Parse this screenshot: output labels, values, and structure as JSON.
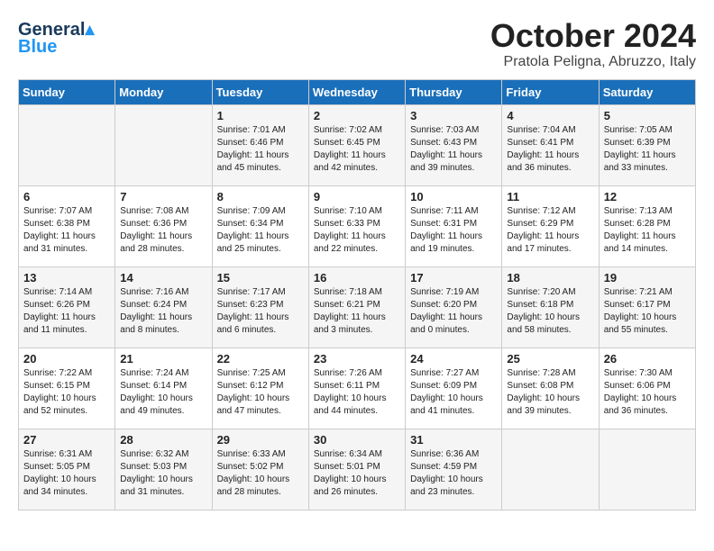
{
  "header": {
    "logo_general": "General",
    "logo_blue": "Blue",
    "month_title": "October 2024",
    "location": "Pratola Peligna, Abruzzo, Italy"
  },
  "days_of_week": [
    "Sunday",
    "Monday",
    "Tuesday",
    "Wednesday",
    "Thursday",
    "Friday",
    "Saturday"
  ],
  "weeks": [
    [
      {
        "day": "",
        "content": ""
      },
      {
        "day": "",
        "content": ""
      },
      {
        "day": "1",
        "content": "Sunrise: 7:01 AM\nSunset: 6:46 PM\nDaylight: 11 hours and 45 minutes."
      },
      {
        "day": "2",
        "content": "Sunrise: 7:02 AM\nSunset: 6:45 PM\nDaylight: 11 hours and 42 minutes."
      },
      {
        "day": "3",
        "content": "Sunrise: 7:03 AM\nSunset: 6:43 PM\nDaylight: 11 hours and 39 minutes."
      },
      {
        "day": "4",
        "content": "Sunrise: 7:04 AM\nSunset: 6:41 PM\nDaylight: 11 hours and 36 minutes."
      },
      {
        "day": "5",
        "content": "Sunrise: 7:05 AM\nSunset: 6:39 PM\nDaylight: 11 hours and 33 minutes."
      }
    ],
    [
      {
        "day": "6",
        "content": "Sunrise: 7:07 AM\nSunset: 6:38 PM\nDaylight: 11 hours and 31 minutes."
      },
      {
        "day": "7",
        "content": "Sunrise: 7:08 AM\nSunset: 6:36 PM\nDaylight: 11 hours and 28 minutes."
      },
      {
        "day": "8",
        "content": "Sunrise: 7:09 AM\nSunset: 6:34 PM\nDaylight: 11 hours and 25 minutes."
      },
      {
        "day": "9",
        "content": "Sunrise: 7:10 AM\nSunset: 6:33 PM\nDaylight: 11 hours and 22 minutes."
      },
      {
        "day": "10",
        "content": "Sunrise: 7:11 AM\nSunset: 6:31 PM\nDaylight: 11 hours and 19 minutes."
      },
      {
        "day": "11",
        "content": "Sunrise: 7:12 AM\nSunset: 6:29 PM\nDaylight: 11 hours and 17 minutes."
      },
      {
        "day": "12",
        "content": "Sunrise: 7:13 AM\nSunset: 6:28 PM\nDaylight: 11 hours and 14 minutes."
      }
    ],
    [
      {
        "day": "13",
        "content": "Sunrise: 7:14 AM\nSunset: 6:26 PM\nDaylight: 11 hours and 11 minutes."
      },
      {
        "day": "14",
        "content": "Sunrise: 7:16 AM\nSunset: 6:24 PM\nDaylight: 11 hours and 8 minutes."
      },
      {
        "day": "15",
        "content": "Sunrise: 7:17 AM\nSunset: 6:23 PM\nDaylight: 11 hours and 6 minutes."
      },
      {
        "day": "16",
        "content": "Sunrise: 7:18 AM\nSunset: 6:21 PM\nDaylight: 11 hours and 3 minutes."
      },
      {
        "day": "17",
        "content": "Sunrise: 7:19 AM\nSunset: 6:20 PM\nDaylight: 11 hours and 0 minutes."
      },
      {
        "day": "18",
        "content": "Sunrise: 7:20 AM\nSunset: 6:18 PM\nDaylight: 10 hours and 58 minutes."
      },
      {
        "day": "19",
        "content": "Sunrise: 7:21 AM\nSunset: 6:17 PM\nDaylight: 10 hours and 55 minutes."
      }
    ],
    [
      {
        "day": "20",
        "content": "Sunrise: 7:22 AM\nSunset: 6:15 PM\nDaylight: 10 hours and 52 minutes."
      },
      {
        "day": "21",
        "content": "Sunrise: 7:24 AM\nSunset: 6:14 PM\nDaylight: 10 hours and 49 minutes."
      },
      {
        "day": "22",
        "content": "Sunrise: 7:25 AM\nSunset: 6:12 PM\nDaylight: 10 hours and 47 minutes."
      },
      {
        "day": "23",
        "content": "Sunrise: 7:26 AM\nSunset: 6:11 PM\nDaylight: 10 hours and 44 minutes."
      },
      {
        "day": "24",
        "content": "Sunrise: 7:27 AM\nSunset: 6:09 PM\nDaylight: 10 hours and 41 minutes."
      },
      {
        "day": "25",
        "content": "Sunrise: 7:28 AM\nSunset: 6:08 PM\nDaylight: 10 hours and 39 minutes."
      },
      {
        "day": "26",
        "content": "Sunrise: 7:30 AM\nSunset: 6:06 PM\nDaylight: 10 hours and 36 minutes."
      }
    ],
    [
      {
        "day": "27",
        "content": "Sunrise: 6:31 AM\nSunset: 5:05 PM\nDaylight: 10 hours and 34 minutes."
      },
      {
        "day": "28",
        "content": "Sunrise: 6:32 AM\nSunset: 5:03 PM\nDaylight: 10 hours and 31 minutes."
      },
      {
        "day": "29",
        "content": "Sunrise: 6:33 AM\nSunset: 5:02 PM\nDaylight: 10 hours and 28 minutes."
      },
      {
        "day": "30",
        "content": "Sunrise: 6:34 AM\nSunset: 5:01 PM\nDaylight: 10 hours and 26 minutes."
      },
      {
        "day": "31",
        "content": "Sunrise: 6:36 AM\nSunset: 4:59 PM\nDaylight: 10 hours and 23 minutes."
      },
      {
        "day": "",
        "content": ""
      },
      {
        "day": "",
        "content": ""
      }
    ]
  ]
}
